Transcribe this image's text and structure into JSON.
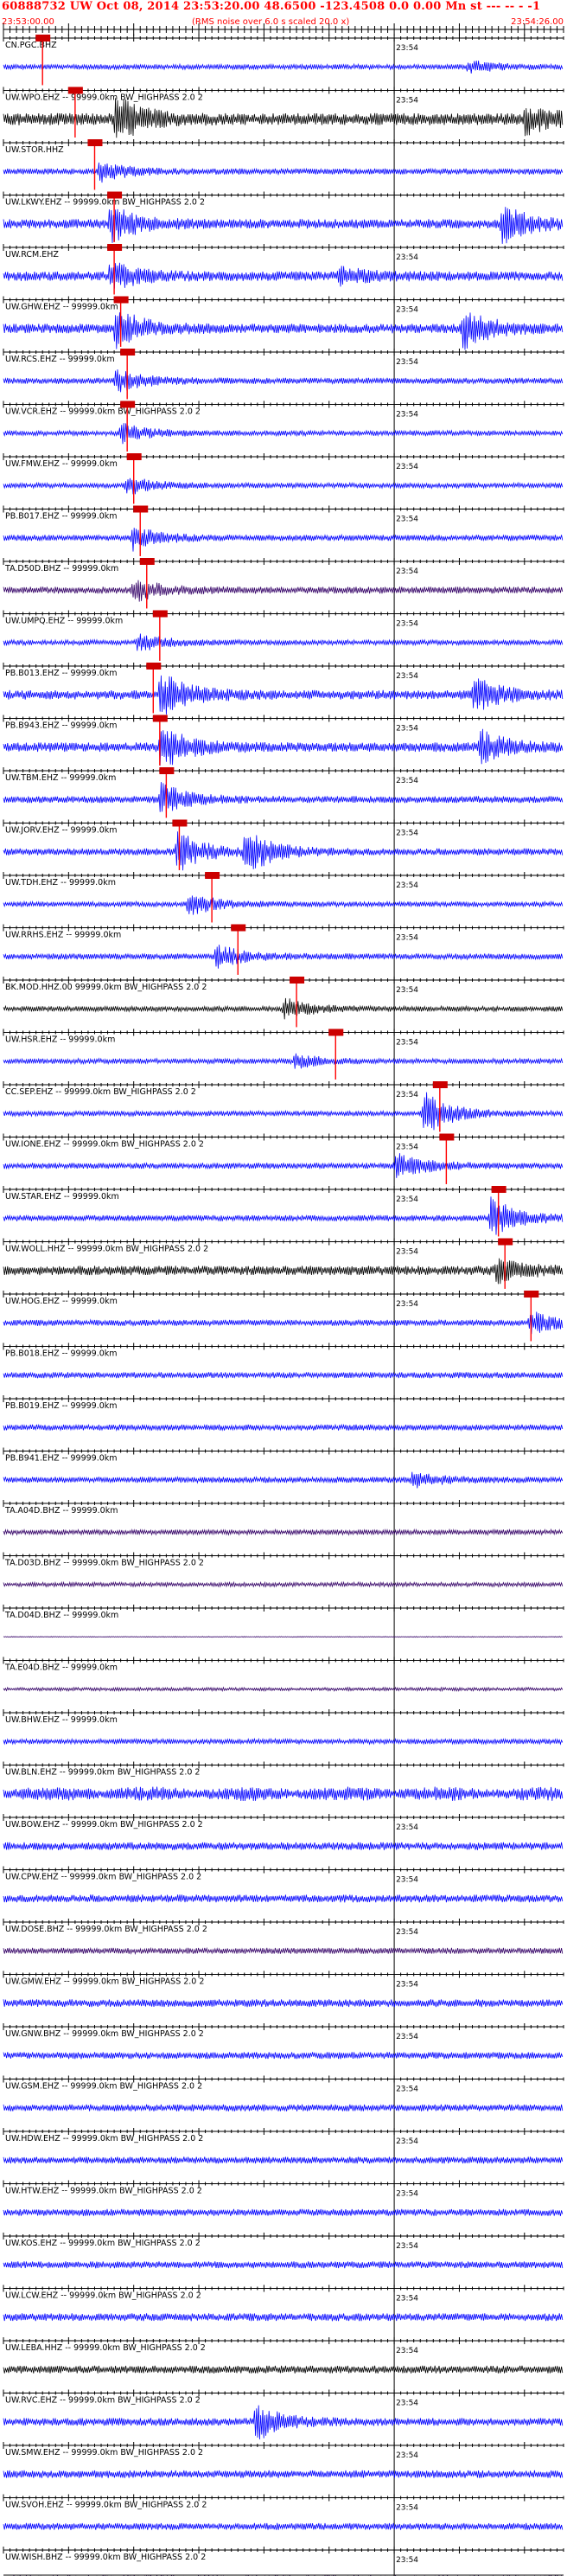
{
  "header": {
    "title": "60888732 UW Oct 08, 2014 23:53:20.00   48.6500 -123.4508  0.0 0.00 Mn st --- -- -  -1",
    "start_time": "23:53:00.00",
    "rms_note": "(RMS noise over 6.0 s scaled 20.0 x)",
    "end_time": "23:54:26.00"
  },
  "colors": {
    "header": "#ff0000",
    "trace_blue": "#0000ff",
    "trace_black": "#000000",
    "trace_purple": "#330066",
    "pick": "#ff0000",
    "grid": "#000000"
  },
  "chart_data": {
    "type": "seismogram",
    "time_axis": {
      "start": "23:53:00.00",
      "end": "23:54:26.00",
      "minute_mark": "23:54"
    },
    "channels": [
      {
        "label": "CN.PGC.BHZ",
        "pick": "23:53:06",
        "amp": 0.3,
        "color": "#0000ff",
        "minute_label": true,
        "burst": [
          {
            "t": 0.83,
            "a": 0.25
          }
        ]
      },
      {
        "label": "UW.WPO.EHZ -- 99999.0km BW_HIGHPASS  2.0  2",
        "pick": "23:53:11",
        "amp": 0.7,
        "color": "#000000",
        "minute_label": true,
        "burst": [
          {
            "t": 0.2,
            "a": 1.0
          },
          {
            "t": 0.93,
            "a": 0.6
          }
        ]
      },
      {
        "label": "UW.STOR.HHZ",
        "pick": "23:53:14",
        "amp": 0.35,
        "color": "#0000ff",
        "minute_label": false,
        "burst": [
          {
            "t": 0.17,
            "a": 0.45
          }
        ]
      },
      {
        "label": "UW.LKWY.EHZ -- 99999.0km BW_HIGHPASS  2.0  2",
        "pick": "23:53:17",
        "amp": 0.55,
        "color": "#0000ff",
        "minute_label": false,
        "burst": [
          {
            "t": 0.19,
            "a": 0.8
          },
          {
            "t": 0.89,
            "a": 0.8
          }
        ]
      },
      {
        "label": "UW.RCM.EHZ",
        "pick": "23:53:17",
        "amp": 0.55,
        "color": "#0000ff",
        "minute_label": true,
        "burst": [
          {
            "t": 0.19,
            "a": 0.6
          },
          {
            "t": 0.6,
            "a": 0.35
          }
        ]
      },
      {
        "label": "UW.GHW.EHZ -- 99999.0km",
        "pick": "23:53:18",
        "amp": 0.55,
        "color": "#0000ff",
        "minute_label": true,
        "burst": [
          {
            "t": 0.2,
            "a": 0.9
          },
          {
            "t": 0.82,
            "a": 0.9
          }
        ]
      },
      {
        "label": "UW.RCS.EHZ -- 99999.0km",
        "pick": "23:53:19",
        "amp": 0.35,
        "color": "#0000ff",
        "minute_label": true,
        "burst": [
          {
            "t": 0.2,
            "a": 0.5
          }
        ]
      },
      {
        "label": "UW.VCR.EHZ -- 99999.0km BW_HIGHPASS  2.0  2",
        "pick": "23:53:19",
        "amp": 0.3,
        "color": "#0000ff",
        "minute_label": true,
        "burst": [
          {
            "t": 0.21,
            "a": 0.4
          }
        ]
      },
      {
        "label": "UW.FMW.EHZ -- 99999.0km",
        "pick": "23:53:20",
        "amp": 0.3,
        "color": "#0000ff",
        "minute_label": true,
        "burst": [
          {
            "t": 0.22,
            "a": 0.4
          }
        ]
      },
      {
        "label": "PB.B017.EHZ -- 99999.0km",
        "pick": "23:53:21",
        "amp": 0.35,
        "color": "#0000ff",
        "minute_label": true,
        "burst": [
          {
            "t": 0.23,
            "a": 0.5
          }
        ]
      },
      {
        "label": "TA.D50D.BHZ -- 99999.0km",
        "pick": "23:53:22",
        "amp": 0.4,
        "color": "#330066",
        "minute_label": true,
        "burst": [
          {
            "t": 0.23,
            "a": 0.5
          }
        ]
      },
      {
        "label": "UW.UMPQ.EHZ -- 99999.0km",
        "pick": "23:53:24",
        "amp": 0.3,
        "color": "#0000ff",
        "minute_label": true,
        "burst": [
          {
            "t": 0.24,
            "a": 0.4
          }
        ]
      },
      {
        "label": "PB.B013.EHZ -- 99999.0km",
        "pick": "23:53:23",
        "amp": 0.55,
        "color": "#0000ff",
        "minute_label": true,
        "burst": [
          {
            "t": 0.28,
            "a": 1.0
          },
          {
            "t": 0.84,
            "a": 0.7
          }
        ]
      },
      {
        "label": "PB.B943.EHZ -- 99999.0km",
        "pick": "23:53:24",
        "amp": 0.55,
        "color": "#0000ff",
        "minute_label": true,
        "burst": [
          {
            "t": 0.28,
            "a": 1.0
          },
          {
            "t": 0.85,
            "a": 0.7
          }
        ]
      },
      {
        "label": "UW.TBM.EHZ -- 99999.0km",
        "pick": "23:53:25",
        "amp": 0.4,
        "color": "#0000ff",
        "minute_label": true,
        "burst": [
          {
            "t": 0.28,
            "a": 0.7
          }
        ]
      },
      {
        "label": "UW.JORV.EHZ -- 99999.0km",
        "pick": "23:53:27",
        "amp": 0.4,
        "color": "#0000ff",
        "minute_label": true,
        "burst": [
          {
            "t": 0.31,
            "a": 0.9
          },
          {
            "t": 0.43,
            "a": 1.0
          }
        ]
      },
      {
        "label": "UW.TDH.EHZ -- 99999.0km",
        "pick": "23:53:32",
        "amp": 0.3,
        "color": "#0000ff",
        "minute_label": true,
        "burst": [
          {
            "t": 0.33,
            "a": 0.5
          }
        ]
      },
      {
        "label": "UW.RRHS.EHZ -- 99999.0km",
        "pick": "23:53:36",
        "amp": 0.35,
        "color": "#0000ff",
        "minute_label": true,
        "burst": [
          {
            "t": 0.38,
            "a": 0.5
          }
        ]
      },
      {
        "label": "BK.MOD.HHZ.00 99999.0km BW_HIGHPASS  2.0  2",
        "pick": "23:53:45",
        "amp": 0.3,
        "color": "#000000",
        "minute_label": true,
        "burst": [
          {
            "t": 0.5,
            "a": 0.5
          }
        ]
      },
      {
        "label": "UW.HSR.EHZ -- 99999.0km",
        "pick": "23:53:51",
        "amp": 0.3,
        "color": "#0000ff",
        "minute_label": true,
        "burst": [
          {
            "t": 0.52,
            "a": 0.3
          }
        ]
      },
      {
        "label": "CC.SEP.EHZ -- 99999.0km BW_HIGHPASS  2.0  2",
        "pick": "23:54:07",
        "amp": 0.3,
        "color": "#0000ff",
        "minute_label": true,
        "burst": [
          {
            "t": 0.75,
            "a": 1.0
          }
        ]
      },
      {
        "label": "UW.IONE.EHZ -- 99999.0km BW_HIGHPASS  2.0  2",
        "pick": "23:54:08",
        "amp": 0.35,
        "color": "#0000ff",
        "minute_label": true,
        "burst": [
          {
            "t": 0.7,
            "a": 0.6
          }
        ]
      },
      {
        "label": "UW.STAR.EHZ -- 99999.0km",
        "pick": "23:54:16",
        "amp": 0.35,
        "color": "#0000ff",
        "minute_label": true,
        "burst": [
          {
            "t": 0.87,
            "a": 0.9
          }
        ]
      },
      {
        "label": "UW.WOLL.HHZ -- 99999.0km BW_HIGHPASS  2.0  2",
        "pick": "23:54:17",
        "amp": 0.55,
        "color": "#000000",
        "minute_label": true,
        "burst": [
          {
            "t": 0.88,
            "a": 0.5
          }
        ]
      },
      {
        "label": "UW.HOG.EHZ -- 99999.0km",
        "pick": "23:54:21",
        "amp": 0.35,
        "color": "#0000ff",
        "minute_label": true,
        "burst": [
          {
            "t": 0.94,
            "a": 0.5
          }
        ]
      },
      {
        "label": "PB.B018.EHZ -- 99999.0km",
        "pick": null,
        "amp": 0.35,
        "color": "#0000ff",
        "minute_label": false,
        "burst": []
      },
      {
        "label": "PB.B019.EHZ -- 99999.0km",
        "pick": null,
        "amp": 0.35,
        "color": "#0000ff",
        "minute_label": false,
        "burst": []
      },
      {
        "label": "PB.B941.EHZ -- 99999.0km",
        "pick": null,
        "amp": 0.35,
        "color": "#0000ff",
        "minute_label": false,
        "burst": [
          {
            "t": 0.73,
            "a": 0.3
          }
        ]
      },
      {
        "label": "TA.A04D.BHZ -- 99999.0km",
        "pick": null,
        "amp": 0.3,
        "color": "#330066",
        "minute_label": false,
        "burst": []
      },
      {
        "label": "TA.D03D.BHZ -- 99999.0km BW_HIGHPASS  2.0  2",
        "pick": null,
        "amp": 0.25,
        "color": "#330066",
        "minute_label": false,
        "burst": []
      },
      {
        "label": "TA.D04D.BHZ -- 99999.0km",
        "pick": null,
        "amp": 0.05,
        "color": "#330066",
        "minute_label": false,
        "burst": []
      },
      {
        "label": "TA.E04D.BHZ -- 99999.0km",
        "pick": null,
        "amp": 0.2,
        "color": "#330066",
        "minute_label": false,
        "burst": []
      },
      {
        "label": "UW.BHW.EHZ -- 99999.0km",
        "pick": null,
        "amp": 0.3,
        "color": "#0000ff",
        "minute_label": false,
        "burst": []
      },
      {
        "label": "UW.BLN.EHZ -- 99999.0km BW_HIGHPASS  2.0  2",
        "pick": null,
        "amp": 0.7,
        "color": "#0000ff",
        "minute_label": false,
        "burst": []
      },
      {
        "label": "UW.BOW.EHZ -- 99999.0km BW_HIGHPASS  2.0  2",
        "pick": null,
        "amp": 0.45,
        "color": "#0000ff",
        "minute_label": true,
        "burst": []
      },
      {
        "label": "UW.CPW.EHZ -- 99999.0km BW_HIGHPASS  2.0  2",
        "pick": null,
        "amp": 0.45,
        "color": "#0000ff",
        "minute_label": true,
        "burst": []
      },
      {
        "label": "UW.DOSE.BHZ -- 99999.0km BW_HIGHPASS  2.0  2",
        "pick": null,
        "amp": 0.35,
        "color": "#330066",
        "minute_label": true,
        "burst": []
      },
      {
        "label": "UW.GMW.EHZ -- 99999.0km BW_HIGHPASS  2.0  2",
        "pick": null,
        "amp": 0.45,
        "color": "#0000ff",
        "minute_label": true,
        "burst": []
      },
      {
        "label": "UW.GNW.BHZ -- 99999.0km BW_HIGHPASS  2.0  2",
        "pick": null,
        "amp": 0.4,
        "color": "#0000ff",
        "minute_label": true,
        "burst": []
      },
      {
        "label": "UW.GSM.EHZ -- 99999.0km BW_HIGHPASS  2.0  2",
        "pick": null,
        "amp": 0.4,
        "color": "#0000ff",
        "minute_label": true,
        "burst": []
      },
      {
        "label": "UW.HDW.EHZ -- 99999.0km BW_HIGHPASS  2.0  2",
        "pick": null,
        "amp": 0.4,
        "color": "#0000ff",
        "minute_label": true,
        "burst": []
      },
      {
        "label": "UW.HTW.EHZ -- 99999.0km BW_HIGHPASS  2.0  2",
        "pick": null,
        "amp": 0.4,
        "color": "#0000ff",
        "minute_label": true,
        "burst": []
      },
      {
        "label": "UW.KOS.EHZ -- 99999.0km BW_HIGHPASS  2.0  2",
        "pick": null,
        "amp": 0.4,
        "color": "#0000ff",
        "minute_label": true,
        "burst": []
      },
      {
        "label": "UW.LCW.EHZ -- 99999.0km BW_HIGHPASS  2.0  2",
        "pick": null,
        "amp": 0.45,
        "color": "#0000ff",
        "minute_label": true,
        "burst": []
      },
      {
        "label": "UW.LEBA.HHZ -- 99999.0km BW_HIGHPASS  2.0  2",
        "pick": null,
        "amp": 0.45,
        "color": "#000000",
        "minute_label": true,
        "burst": []
      },
      {
        "label": "UW.RVC.EHZ -- 99999.0km BW_HIGHPASS  2.0  2",
        "pick": null,
        "amp": 0.45,
        "color": "#0000ff",
        "minute_label": true,
        "burst": [
          {
            "t": 0.45,
            "a": 0.8
          }
        ]
      },
      {
        "label": "UW.SMW.EHZ -- 99999.0km BW_HIGHPASS  2.0  2",
        "pick": null,
        "amp": 0.45,
        "color": "#0000ff",
        "minute_label": true,
        "burst": []
      },
      {
        "label": "UW.SVOH.EHZ -- 99999.0km BW_HIGHPASS  2.0  2",
        "pick": null,
        "amp": 0.4,
        "color": "#0000ff",
        "minute_label": true,
        "burst": []
      },
      {
        "label": "UW.WISH.BHZ -- 99999.0km BW_HIGHPASS  2.0  2",
        "pick": null,
        "amp": 0.4,
        "color": "#330066",
        "minute_label": true,
        "burst": []
      }
    ]
  }
}
